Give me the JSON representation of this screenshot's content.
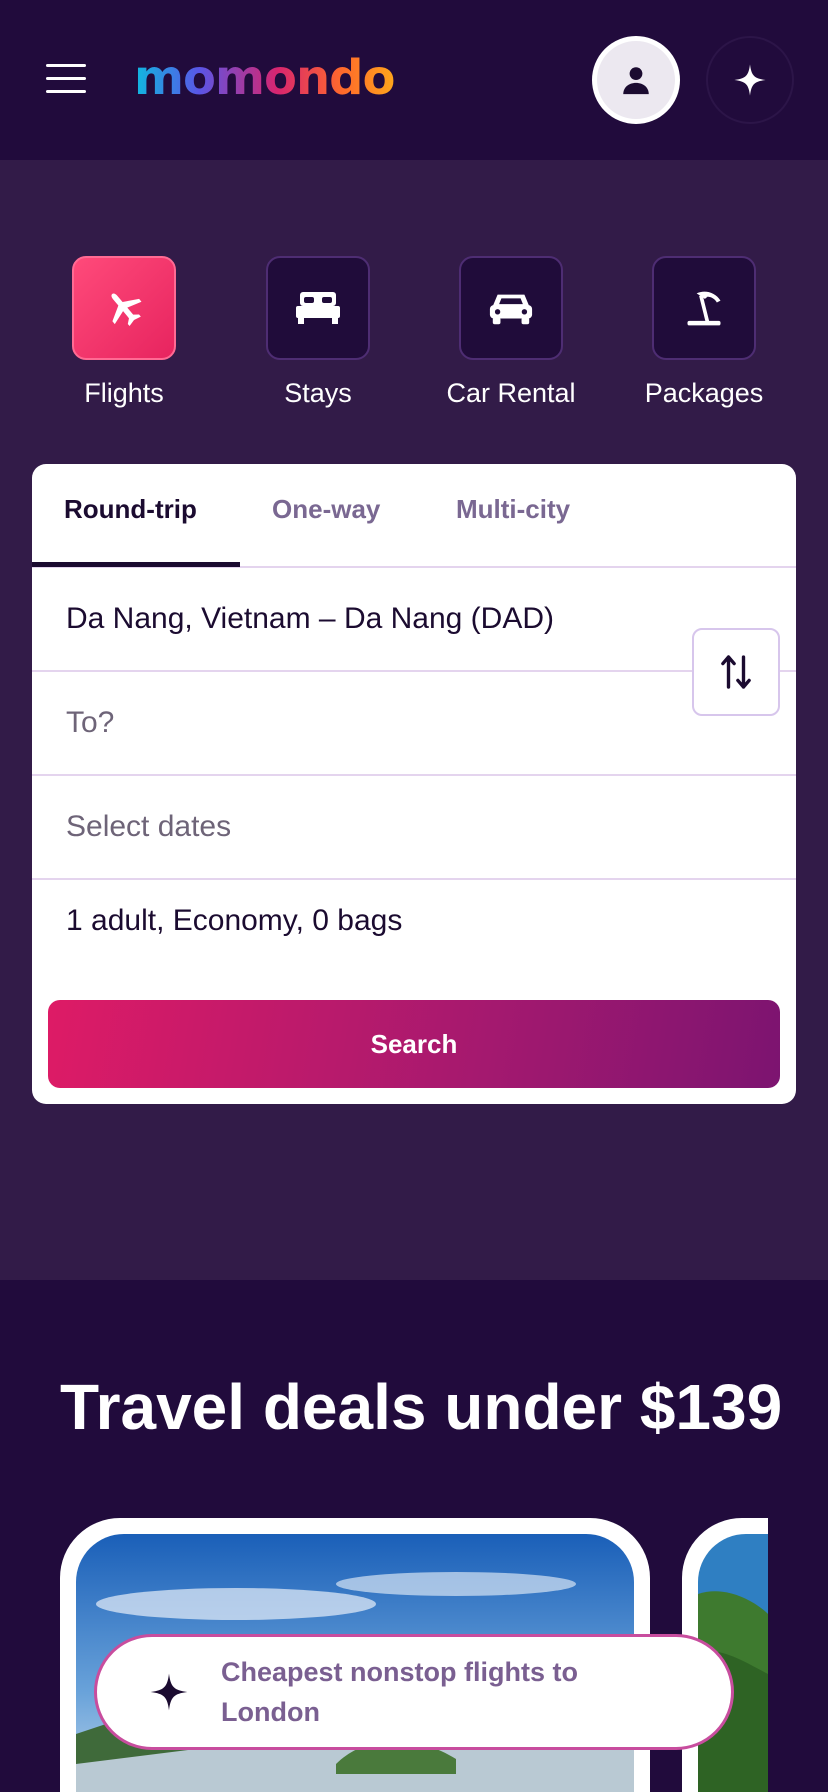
{
  "header": {
    "brand": "momondo",
    "account_icon": "person-icon",
    "ai_icon": "sparkle-icon",
    "menu_icon": "hamburger-icon"
  },
  "verticals": [
    {
      "label": "Flights",
      "icon": "airplane-icon",
      "active": true
    },
    {
      "label": "Stays",
      "icon": "bed-icon",
      "active": false
    },
    {
      "label": "Car Rental",
      "icon": "car-icon",
      "active": false
    },
    {
      "label": "Packages",
      "icon": "beach-umbrella-icon",
      "active": false
    }
  ],
  "search": {
    "trip_types": [
      "Round-trip",
      "One-way",
      "Multi-city"
    ],
    "selected_trip_type": "Round-trip",
    "origin_value": "Da Nang, Vietnam – Da Nang (DAD)",
    "destination_placeholder": "To?",
    "dates_placeholder": "Select dates",
    "travelers_value": "1 adult, Economy, 0 bags",
    "search_label": "Search",
    "swap_icon": "swap-vertical-icon"
  },
  "deals": {
    "title": "Travel deals under $139",
    "chip_label": "Cheapest nonstop flights to London",
    "chip_icon": "sparkle-icon"
  },
  "colors": {
    "header_bg": "#210b3c",
    "hero_bg": "#321b48",
    "accent_pink": "#e7245f",
    "search_gradient_end": "#7c1470"
  }
}
